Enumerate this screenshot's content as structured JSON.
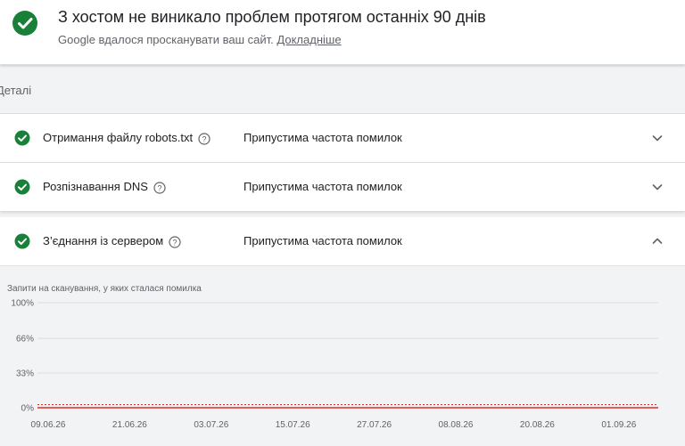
{
  "summary": {
    "title": "З хостом не виникало проблем протягом останніх 90 днів",
    "subtitle": "Google вдалося просканувати ваш сайт.",
    "link": "Докладніше"
  },
  "details_label": "Деталі",
  "rows": [
    {
      "name": "Отримання файлу robots.txt",
      "status": "Припустима частота помилок",
      "expanded": false
    },
    {
      "name": "Розпізнавання DNS",
      "status": "Припустима частота помилок",
      "expanded": false
    },
    {
      "name": "З’єднання із сервером",
      "status": "Припустима частота помилок",
      "expanded": true
    }
  ],
  "chart_data": {
    "type": "line",
    "title": "Запити на сканування, у яких сталася помилка",
    "y_ticks": [
      "100%",
      "66%",
      "33%",
      "0%"
    ],
    "ylim": [
      0,
      100
    ],
    "x_ticks": [
      "09.06.26",
      "21.06.26",
      "03.07.26",
      "15.07.26",
      "27.07.26",
      "08.08.26",
      "20.08.26",
      "01.09.26"
    ],
    "series": [
      {
        "values": [
          0,
          0,
          0,
          0,
          0,
          0,
          0,
          0
        ],
        "color": "#d93025"
      }
    ],
    "threshold": 3,
    "grid": true
  },
  "colors": {
    "check": "#188038",
    "line": "#d93025",
    "grid": "#dadce0"
  }
}
